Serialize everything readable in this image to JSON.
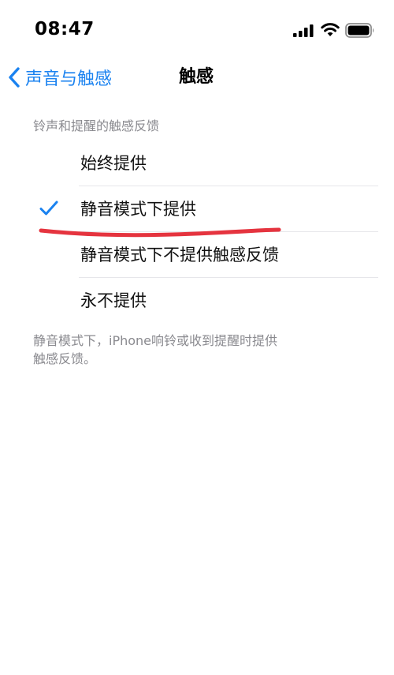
{
  "status_bar": {
    "time": "08:47",
    "icons": [
      "signal-icon",
      "wifi-icon",
      "battery-icon"
    ]
  },
  "nav": {
    "back_label": "声音与触感",
    "title": "触感"
  },
  "section": {
    "header": "铃声和提醒的触感反馈",
    "options": [
      {
        "label": "始终提供",
        "selected": false
      },
      {
        "label": "静音模式下提供",
        "selected": true
      },
      {
        "label": "静音模式下不提供触感反馈",
        "selected": false
      },
      {
        "label": "永不提供",
        "selected": false
      }
    ],
    "footer_line1": "静音模式下，iPhone响铃或收到提醒时提供",
    "footer_line2": "触感反馈。"
  },
  "colors": {
    "accent": "#1a82f0",
    "annotation": "#e5343f",
    "secondary_text": "#8a8a8f"
  }
}
